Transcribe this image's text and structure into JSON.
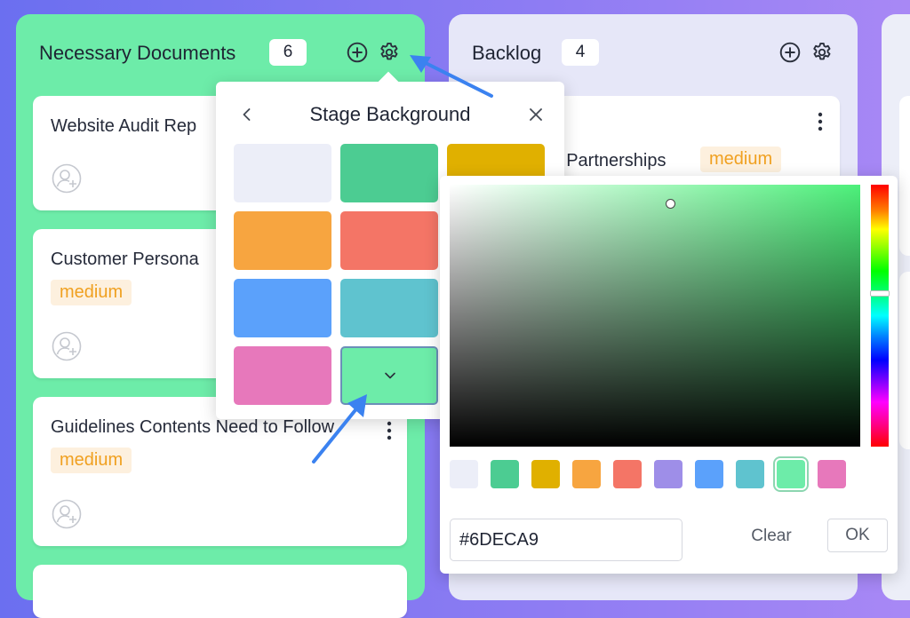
{
  "stages": [
    {
      "title": "Necessary Documents",
      "count": "6",
      "cards": [
        {
          "title": "Website Audit Rep",
          "tag": ""
        },
        {
          "title": "Customer Persona",
          "tag": "medium"
        },
        {
          "title": "Guidelines Contents Need to Follow",
          "tag": "medium"
        }
      ]
    },
    {
      "title": "Backlog",
      "count": "4",
      "cards": [
        {
          "title": "r Partnerships",
          "tag": "medium"
        }
      ]
    }
  ],
  "background_popover": {
    "title": "Stage Background",
    "swatches": [
      "#eceef8",
      "#4ccc92",
      "#e0b000",
      "#f7a540",
      "#f47566",
      "#5ba1fb",
      "#5fc3cf",
      "#e778bb",
      "#6deca9"
    ],
    "selected_index": 8
  },
  "color_picker": {
    "hex_value": "#6DECA9",
    "palette": [
      "#eceef8",
      "#4ccc92",
      "#e0b000",
      "#f7a540",
      "#f47566",
      "#9e8ee8",
      "#5ba1fb",
      "#5fc3cf",
      "#6deca9",
      "#e778bb"
    ],
    "selected_palette_index": 8,
    "clear_label": "Clear",
    "ok_label": "OK"
  },
  "icons": {
    "add": "plus-circle-icon",
    "settings": "gear-icon",
    "back": "chevron-left-icon",
    "close": "close-icon",
    "assignee": "add-user-icon",
    "dropdown": "chevron-down-icon",
    "more": "kebab-icon"
  }
}
